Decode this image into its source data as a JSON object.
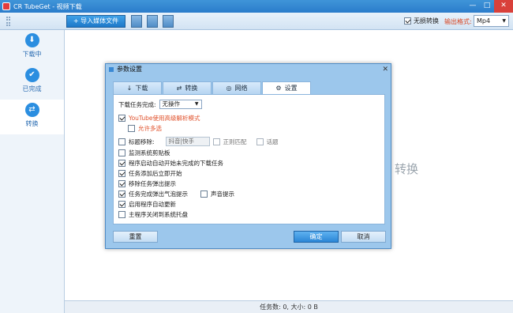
{
  "window": {
    "title": "CR TubeGet - 视频下载",
    "controls": [
      "—",
      "□",
      "✕"
    ]
  },
  "toolbar": {
    "import_label": "+ 导入媒体文件",
    "no_delete_label": "无损转换",
    "no_delete_checked": true,
    "output_label": "输出格式:",
    "output_value": "Mp4"
  },
  "sidebar": {
    "items": [
      {
        "label": "下载中",
        "icon": "download-icon",
        "glyph": "⬇",
        "active": false
      },
      {
        "label": "已完成",
        "icon": "check-icon",
        "glyph": "✔",
        "active": false
      },
      {
        "label": "转换",
        "icon": "convert-icon",
        "glyph": "⇄",
        "active": true
      }
    ]
  },
  "content": {
    "background_label": "转换"
  },
  "status": {
    "text": "任务数: 0, 大小: 0 B"
  },
  "dialog": {
    "title": "参数设置",
    "tabs": [
      {
        "label": "下载",
        "icon": "↓"
      },
      {
        "label": "转换",
        "icon": "⇄"
      },
      {
        "label": "网络",
        "icon": "◎"
      },
      {
        "label": "设置",
        "icon": "⚙"
      }
    ],
    "active_tab": "设置",
    "settings": {
      "on_complete_label": "下载任务完成:",
      "on_complete_value": "无操作",
      "youtube_advanced": {
        "label": "YouTube使用高级解析模式",
        "checked": true
      },
      "allow_multi": {
        "label": "允许多选",
        "checked": false
      },
      "title_remove": {
        "label": "标题移除:",
        "checked": false,
        "placeholder": "抖音|快手"
      },
      "regex": {
        "label": "正则匹配",
        "checked": false
      },
      "topic": {
        "label": "话题",
        "checked": false
      },
      "items": [
        {
          "label": "监测系统剪贴板",
          "checked": false
        },
        {
          "label": "程序启动自动开始未完成的下载任务",
          "checked": true
        },
        {
          "label": "任务添加后立即开始",
          "checked": true
        },
        {
          "label": "移除任务弹出提示",
          "checked": true
        },
        {
          "label": "任务完成弹出气泡提示",
          "checked": true
        },
        {
          "label": "启用程序自动更新",
          "checked": true
        },
        {
          "label": "主程序关闭到系统托盘",
          "checked": false
        }
      ],
      "sound": {
        "label": "声音提示",
        "checked": false
      }
    },
    "buttons": {
      "reset": "重置",
      "ok": "确定",
      "cancel": "取消"
    }
  }
}
